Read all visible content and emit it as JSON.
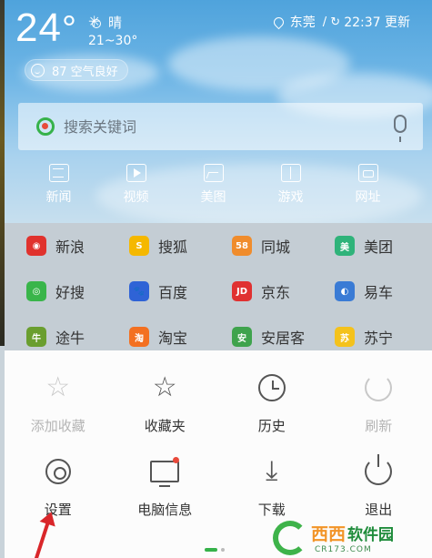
{
  "weather": {
    "temperature": "24",
    "unit": "°",
    "condition": "晴",
    "range": "21~30°",
    "aqi": "87 空气良好",
    "location": "东莞",
    "updated": "22:37 更新"
  },
  "search": {
    "placeholder": "搜索关键词"
  },
  "quick_links": [
    {
      "label": "新闻",
      "icon": "news-icon"
    },
    {
      "label": "视频",
      "icon": "video-icon"
    },
    {
      "label": "美图",
      "icon": "image-icon"
    },
    {
      "label": "游戏",
      "icon": "game-icon"
    },
    {
      "label": "网址",
      "icon": "web-icon"
    }
  ],
  "sites": [
    [
      {
        "label": "新浪",
        "color": "#e0322d",
        "glyph": "◉"
      },
      {
        "label": "搜狐",
        "color": "#f5b800",
        "glyph": "S"
      },
      {
        "label": "同城",
        "color": "#f08c2c",
        "glyph": "58"
      },
      {
        "label": "美团",
        "color": "#2fb37a",
        "glyph": "美"
      }
    ],
    [
      {
        "label": "好搜",
        "color": "#39b54a",
        "glyph": "◎"
      },
      {
        "label": "百度",
        "color": "#2f63d6",
        "glyph": "🐾"
      },
      {
        "label": "京东",
        "color": "#e03131",
        "glyph": "JD"
      },
      {
        "label": "易车",
        "color": "#3a7bd5",
        "glyph": "◐"
      }
    ],
    [
      {
        "label": "途牛",
        "color": "#6a9e2f",
        "glyph": "牛"
      },
      {
        "label": "淘宝",
        "color": "#f37021",
        "glyph": "淘"
      },
      {
        "label": "安居客",
        "color": "#3fa34d",
        "glyph": "安"
      },
      {
        "label": "苏宁",
        "color": "#f4c21c",
        "glyph": "苏"
      }
    ]
  ],
  "menu": {
    "row1": [
      {
        "label": "添加收藏",
        "disabled": true
      },
      {
        "label": "收藏夹",
        "disabled": false
      },
      {
        "label": "历史",
        "disabled": false
      },
      {
        "label": "刷新",
        "disabled": true
      }
    ],
    "row2": [
      {
        "label": "设置"
      },
      {
        "label": "电脑信息"
      },
      {
        "label": "下载"
      },
      {
        "label": "退出"
      }
    ]
  },
  "watermark": {
    "brand": "西西",
    "suffix": "软件园",
    "url": "CR173.COM"
  },
  "colors": {
    "accent": "#36b24a",
    "notice_dot": "#e8493b",
    "annotation_arrow": "#d9262a"
  }
}
